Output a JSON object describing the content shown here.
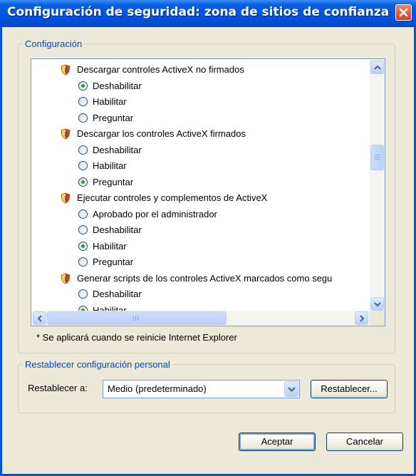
{
  "window": {
    "title": "Configuración de seguridad: zona de sitios de confianza"
  },
  "settings_group": {
    "legend": "Configuración",
    "rows": [
      {
        "kind": "header",
        "text": "Descargar controles ActiveX no firmados"
      },
      {
        "kind": "option",
        "text": "Deshabilitar",
        "checked": true
      },
      {
        "kind": "option",
        "text": "Habilitar",
        "checked": false
      },
      {
        "kind": "option",
        "text": "Preguntar",
        "checked": false
      },
      {
        "kind": "header",
        "text": "Descargar los controles ActiveX firmados"
      },
      {
        "kind": "option",
        "text": "Deshabilitar",
        "checked": false
      },
      {
        "kind": "option",
        "text": "Habilitar",
        "checked": false
      },
      {
        "kind": "option",
        "text": "Preguntar",
        "checked": true
      },
      {
        "kind": "header",
        "text": "Ejecutar controles y complementos de ActiveX"
      },
      {
        "kind": "option",
        "text": "Aprobado por el administrador",
        "checked": false
      },
      {
        "kind": "option",
        "text": "Deshabilitar",
        "checked": false
      },
      {
        "kind": "option",
        "text": "Habilitar",
        "checked": true
      },
      {
        "kind": "option",
        "text": "Preguntar",
        "checked": false
      },
      {
        "kind": "header",
        "text": "Generar scripts de los controles ActiveX marcados como segu"
      },
      {
        "kind": "option",
        "text": "Deshabilitar",
        "checked": false
      },
      {
        "kind": "option",
        "text": "Habilitar",
        "checked": true
      }
    ],
    "footnote": "* Se aplicará cuando se reinicie Internet Explorer"
  },
  "reset_group": {
    "legend": "Restablecer configuración personal",
    "label": "Restablecer a:",
    "selected": "Medio (predeterminado)",
    "reset_button": "Restablecer..."
  },
  "buttons": {
    "ok": "Aceptar",
    "cancel": "Cancelar"
  },
  "icons": {
    "setting": "shield-icon",
    "close": "close-icon",
    "dropdown": "chevron-down-icon"
  },
  "colors": {
    "titlebar": "#0054e3",
    "legend": "#0046d5",
    "dialog": "#ece9d8",
    "checked_dot": "#21a121"
  }
}
